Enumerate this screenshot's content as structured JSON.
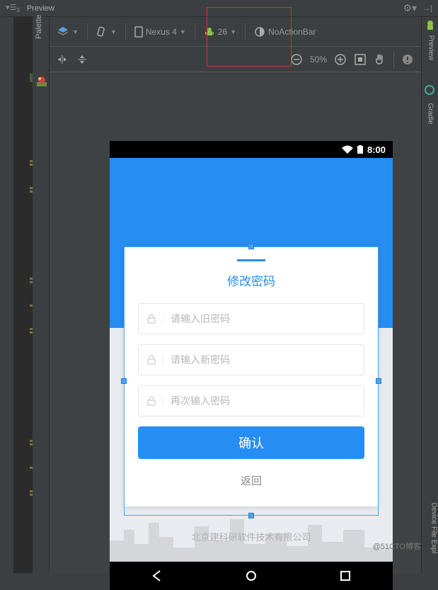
{
  "header": {
    "title": "Preview"
  },
  "palette": {
    "label": "Palette"
  },
  "device_toolbar": {
    "device": "Nexus 4",
    "api": "26",
    "theme": "NoActionBar"
  },
  "view_toolbar": {
    "zoom": "50%"
  },
  "right_panels": {
    "preview": "Preview",
    "gradle": "Gradle",
    "device_file": "Device File Expl"
  },
  "status_bar": {
    "time": "8:00"
  },
  "app": {
    "title": "修改密码",
    "old_password_placeholder": "请输入旧密码",
    "new_password_placeholder": "请输入新密码",
    "confirm_password_placeholder": "再次输入密码",
    "confirm_button": "确认",
    "back_button": "返回",
    "footer": "北京建科研软件技术有限公司"
  },
  "watermark": "@51CTO博客"
}
